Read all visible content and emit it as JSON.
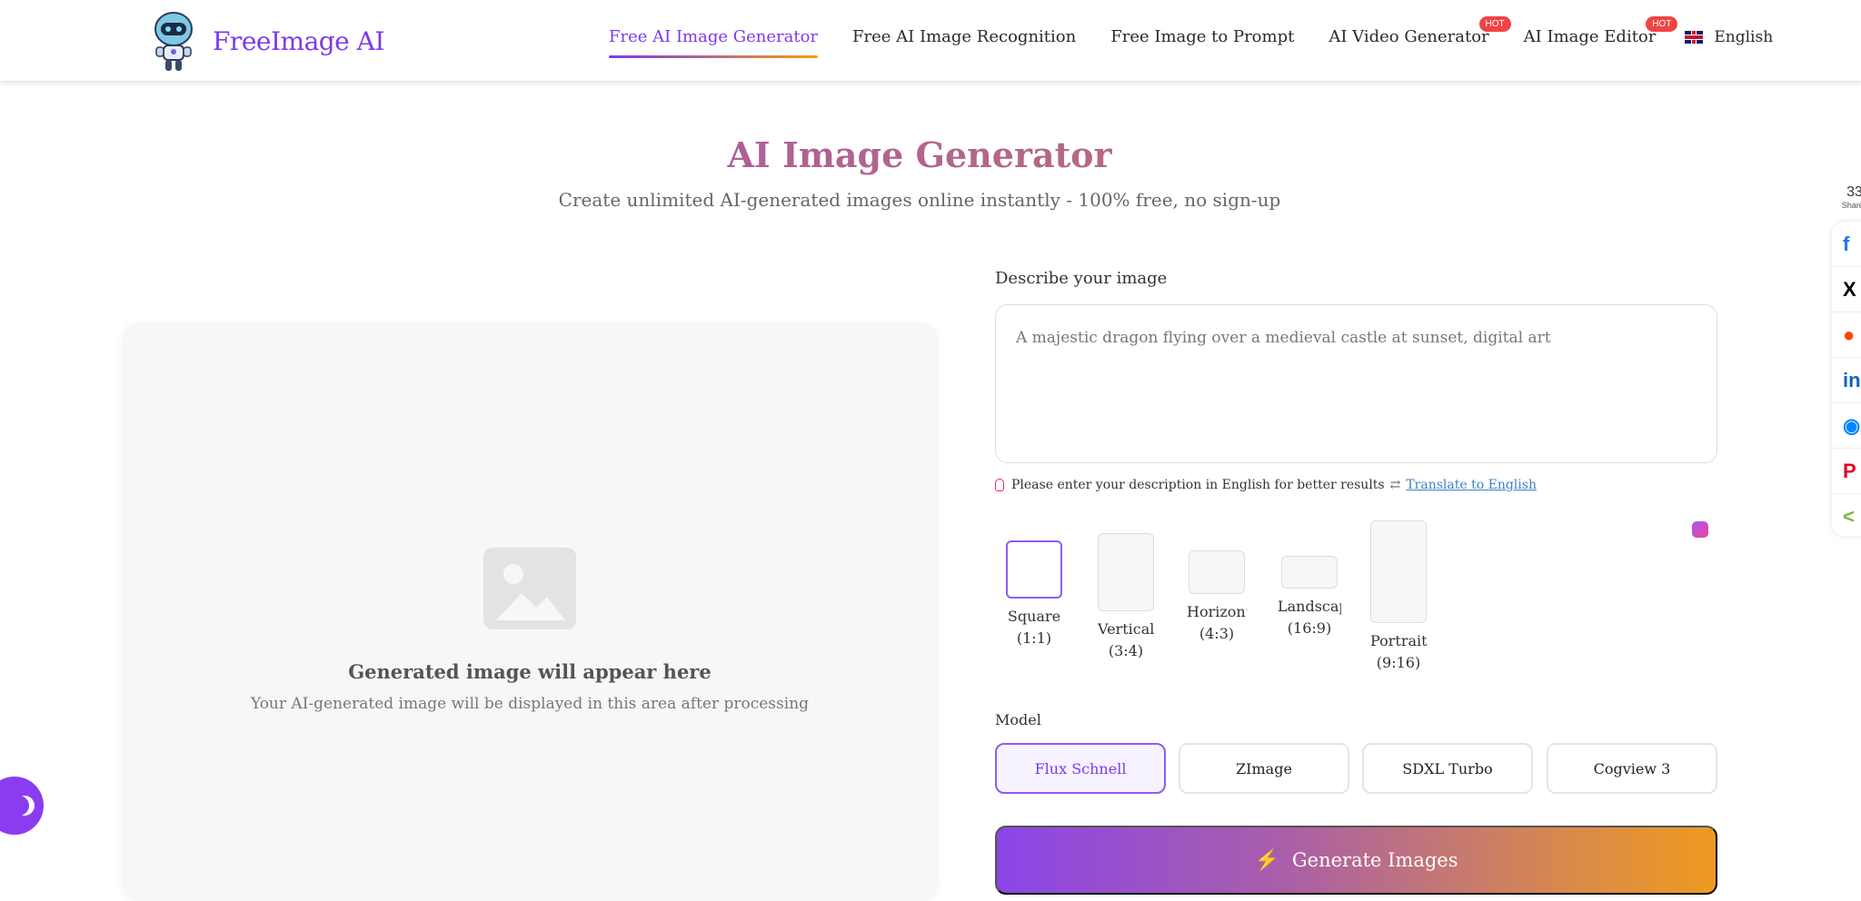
{
  "header": {
    "brand": "FreeImage AI",
    "nav": [
      {
        "label": "Free AI Image Generator",
        "active": true
      },
      {
        "label": "Free AI Image Recognition"
      },
      {
        "label": "Free Image to Prompt"
      },
      {
        "label": "AI Video Generator",
        "badge": "HOT"
      },
      {
        "label": "AI Image Editor",
        "badge": "HOT"
      }
    ],
    "language": "English"
  },
  "hero": {
    "title": "AI Image Generator",
    "subtitle": "Create unlimited AI-generated images online instantly - 100% free, no sign-up"
  },
  "preview": {
    "title": "Generated image will appear here",
    "subtitle": "Your AI-generated image will be displayed in this area after processing"
  },
  "form": {
    "label": "Describe your image",
    "placeholder": "A majestic dragon flying over a medieval castle at sunset, digital art",
    "hint": "Please enter your description in English for better results",
    "translate_link": "Translate to English",
    "ratios": [
      {
        "name": "Square",
        "ratio": "(1:1)",
        "selected": true
      },
      {
        "name": "Vertical",
        "ratio": "(3:4)"
      },
      {
        "name": "Horizonta",
        "ratio": "(4:3)"
      },
      {
        "name": "Landscape",
        "ratio": "(16:9)"
      },
      {
        "name": "Portrait",
        "ratio": "(9:16)"
      }
    ],
    "model_label": "Model",
    "models": [
      {
        "label": "Flux Schnell",
        "active": true
      },
      {
        "label": "ZImage"
      },
      {
        "label": "SDXL Turbo"
      },
      {
        "label": "Cogview 3"
      }
    ],
    "generate_label": "Generate Images"
  },
  "share": {
    "count": "33",
    "count_label": "Shares",
    "items": [
      {
        "icon": "facebook-icon",
        "color": "#1877f2"
      },
      {
        "icon": "x-icon",
        "color": "#000000"
      },
      {
        "icon": "reddit-icon",
        "color": "#ff4500"
      },
      {
        "icon": "linkedin-icon",
        "color": "#0a66c2"
      },
      {
        "icon": "messenger-icon",
        "color": "#0084ff"
      },
      {
        "icon": "pinterest-icon",
        "color": "#e60023"
      },
      {
        "icon": "share-icon",
        "color": "#7cb342"
      }
    ]
  },
  "colors": {
    "accent": "#7c3aed",
    "gradient_end": "#f59e0b",
    "hot_badge": "#ef4444"
  }
}
